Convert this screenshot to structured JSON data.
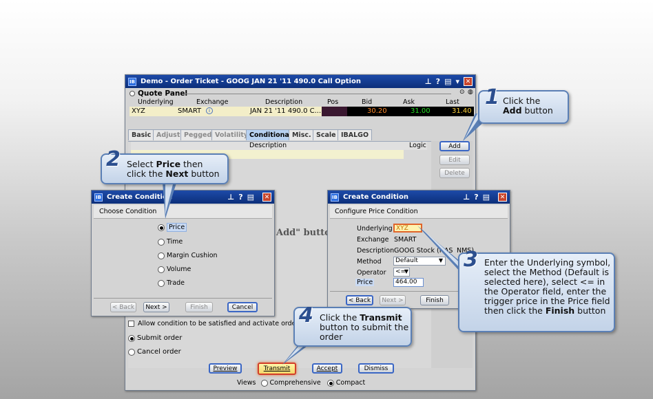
{
  "order_ticket": {
    "title": "Demo - Order Ticket - GOOG JAN 21 '11 490.0 Call Option",
    "quote_panel": {
      "label": "Quote Panel",
      "headers": [
        "Underlying",
        "Exchange",
        "Description",
        "Pos",
        "Bid",
        "Ask",
        "Last"
      ],
      "row": {
        "underlying": "XYZ",
        "exchange": "SMART",
        "description": "JAN 21 '11 490.0 C...",
        "pos": "",
        "bid": "30.20",
        "ask": "31.00",
        "last": "31.40"
      }
    },
    "tabs": [
      "Basic",
      "Adjust",
      "Pegged",
      "Volatility",
      "Conditional",
      "Misc.",
      "Scale",
      "IBALGO"
    ],
    "cond_headers": {
      "description": "Description",
      "logic": "Logic"
    },
    "side_buttons": {
      "add": "Add",
      "edit": "Edit",
      "delete": "Delete"
    },
    "partial_text": "Add\" butto",
    "allow_condition": "Allow condition to be satisfied and activate order out",
    "submit_order": "Submit order",
    "cancel_order": "Cancel order",
    "buttons": {
      "preview": "Preview",
      "transmit": "Transmit",
      "accept": "Accept",
      "dismiss": "Dismiss"
    },
    "views": {
      "label": "Views",
      "comprehensive": "Comprehensive",
      "compact": "Compact"
    }
  },
  "create_condition_1": {
    "title": "Create Condition",
    "header": "Choose Condition",
    "options": [
      "Price",
      "Time",
      "Margin Cushion",
      "Volume",
      "Trade"
    ],
    "selected": "Price",
    "buttons": {
      "back": "< Back",
      "next": "Next >",
      "finish": "Finish",
      "cancel": "Cancel"
    }
  },
  "create_condition_2": {
    "title": "Create Condition",
    "header": "Configure Price Condition",
    "fields": {
      "underlying_label": "Underlying",
      "underlying_value": "XYZ",
      "exchange_label": "Exchange",
      "exchange_value": "SMART",
      "description_label": "Description",
      "description_value": "GOOG Stock (NAS",
      "description_tail": "NMS)",
      "method_label": "Method",
      "method_value": "Default",
      "operator_label": "Operator",
      "operator_value": "<=",
      "price_label": "Price",
      "price_value": "464.00"
    },
    "buttons": {
      "back": "< Back",
      "next": "Next >",
      "finish": "Finish"
    }
  },
  "callouts": {
    "c1": {
      "num": "1",
      "line1": "Click the",
      "bold": "Add",
      "line2": " button"
    },
    "c2": {
      "num": "2",
      "pre": "Select ",
      "bold1": "Price",
      "mid": " then",
      "pre2": "click the ",
      "bold2": "Next",
      "post2": " button"
    },
    "c3": {
      "num": "3",
      "text": "Enter the Underlying symbol, select the Method (Default is selected here), select <= in the Operator field, enter the trigger price in the Price field then click the ",
      "bold": "Finish",
      "post": " button"
    },
    "c4": {
      "num": "4",
      "pre": "Click the ",
      "bold": "Transmit",
      "rest": "button to submit the order"
    }
  },
  "colors": {
    "title_bar": "#0c2f7a",
    "tab_active": "#b7d1f1",
    "highlight_border": "#d33e2a",
    "callout_border": "#5a7fb5"
  }
}
